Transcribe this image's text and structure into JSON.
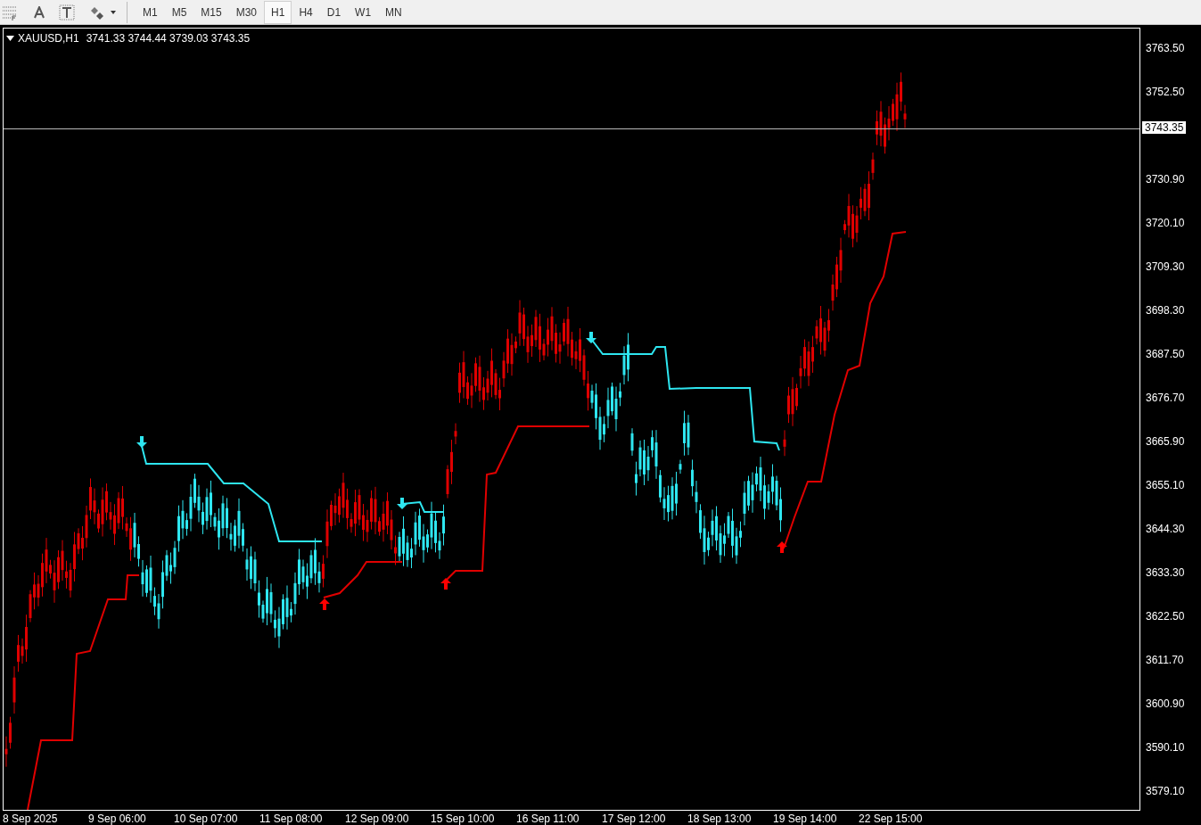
{
  "toolbar": {
    "timeframes": [
      {
        "label": "M1",
        "selected": false
      },
      {
        "label": "M5",
        "selected": false
      },
      {
        "label": "M15",
        "selected": false
      },
      {
        "label": "M30",
        "selected": false
      },
      {
        "label": "H1",
        "selected": true
      },
      {
        "label": "H4",
        "selected": false
      },
      {
        "label": "D1",
        "selected": false
      },
      {
        "label": "W1",
        "selected": false
      },
      {
        "label": "MN",
        "selected": false
      }
    ]
  },
  "chart": {
    "symbol": "XAUUSD,H1",
    "ohlc": "3741.33 3744.44 3739.03 3743.35",
    "current_price": "3743.35",
    "price_labels": [
      "3763.50",
      "3752.50",
      "3730.90",
      "3720.10",
      "3709.30",
      "3698.30",
      "3687.50",
      "3676.70",
      "3665.90",
      "3655.10",
      "3644.30",
      "3633.30",
      "3622.50",
      "3611.70",
      "3600.90",
      "3590.10",
      "3579.10"
    ],
    "time_labels": [
      "8 Sep 2025",
      "9 Sep 06:00",
      "10 Sep 07:00",
      "11 Sep 08:00",
      "12 Sep 09:00",
      "15 Sep 10:00",
      "16 Sep 11:00",
      "17 Sep 12:00",
      "18 Sep 13:00",
      "19 Sep 14:00",
      "22 Sep 15:00"
    ]
  }
}
